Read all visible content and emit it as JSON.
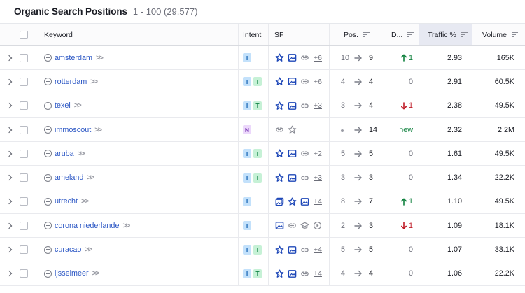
{
  "header": {
    "title": "Organic Search Positions",
    "count": "1 - 100 (29,577)"
  },
  "columns": {
    "keyword": "Keyword",
    "intent": "Intent",
    "sf": "SF",
    "pos": "Pos.",
    "diff": "D...",
    "traffic": "Traffic %",
    "volume": "Volume"
  },
  "rows": [
    {
      "keyword": "amsterdam",
      "intent": [
        "I"
      ],
      "sf": [
        "star",
        "image",
        "link"
      ],
      "sf_more": "+6",
      "pos_from": "10",
      "pos_to": "9",
      "diff": "1",
      "diff_dir": "up",
      "traffic": "2.93",
      "volume": "165K"
    },
    {
      "keyword": "rotterdam",
      "intent": [
        "I",
        "T"
      ],
      "sf": [
        "star",
        "image",
        "link"
      ],
      "sf_more": "+6",
      "pos_from": "4",
      "pos_to": "4",
      "diff": "0",
      "diff_dir": "zero",
      "traffic": "2.91",
      "volume": "60.5K"
    },
    {
      "keyword": "texel",
      "intent": [
        "I",
        "T"
      ],
      "sf": [
        "star",
        "image",
        "link"
      ],
      "sf_more": "+3",
      "pos_from": "3",
      "pos_to": "4",
      "diff": "1",
      "diff_dir": "down",
      "traffic": "2.38",
      "volume": "49.5K"
    },
    {
      "keyword": "immoscout",
      "intent": [
        "N"
      ],
      "sf": [
        "link",
        "star-outline"
      ],
      "sf_more": "",
      "pos_from": "",
      "pos_to": "14",
      "diff": "new",
      "diff_dir": "new",
      "traffic": "2.32",
      "volume": "2.2M"
    },
    {
      "keyword": "aruba",
      "intent": [
        "I",
        "T"
      ],
      "sf": [
        "star",
        "image",
        "link"
      ],
      "sf_more": "+2",
      "pos_from": "5",
      "pos_to": "5",
      "diff": "0",
      "diff_dir": "zero",
      "traffic": "1.61",
      "volume": "49.5K"
    },
    {
      "keyword": "ameland",
      "intent": [
        "I",
        "T"
      ],
      "sf": [
        "star",
        "image",
        "link"
      ],
      "sf_more": "+3",
      "pos_from": "3",
      "pos_to": "3",
      "diff": "0",
      "diff_dir": "zero",
      "traffic": "1.34",
      "volume": "22.2K"
    },
    {
      "keyword": "utrecht",
      "intent": [
        "I"
      ],
      "sf": [
        "gallery",
        "star",
        "image"
      ],
      "sf_more": "+4",
      "pos_from": "8",
      "pos_to": "7",
      "diff": "1",
      "diff_dir": "up",
      "traffic": "1.10",
      "volume": "49.5K"
    },
    {
      "keyword": "corona niederlande",
      "intent": [
        "I"
      ],
      "sf": [
        "image",
        "link",
        "graduation",
        "play"
      ],
      "sf_more": "",
      "pos_from": "2",
      "pos_to": "3",
      "diff": "1",
      "diff_dir": "down",
      "traffic": "1.09",
      "volume": "18.1K"
    },
    {
      "keyword": "curacao",
      "intent": [
        "I",
        "T"
      ],
      "sf": [
        "star",
        "image",
        "link"
      ],
      "sf_more": "+4",
      "pos_from": "5",
      "pos_to": "5",
      "diff": "0",
      "diff_dir": "zero",
      "traffic": "1.07",
      "volume": "33.1K"
    },
    {
      "keyword": "ijsselmeer",
      "intent": [
        "I",
        "T"
      ],
      "sf": [
        "star",
        "image",
        "link"
      ],
      "sf_more": "+4",
      "pos_from": "4",
      "pos_to": "4",
      "diff": "0",
      "diff_dir": "zero",
      "traffic": "1.06",
      "volume": "22.2K"
    }
  ],
  "colors": {
    "link": "#2d58c5",
    "up": "#11823f",
    "down": "#c01d28",
    "sf_blue": "#1f48b8"
  }
}
